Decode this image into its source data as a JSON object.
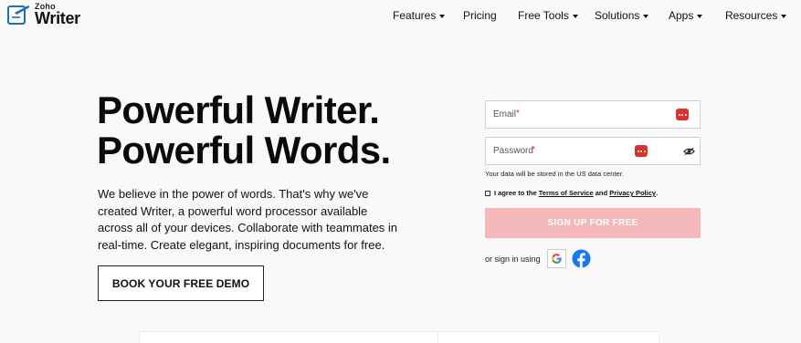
{
  "brand": {
    "zoho": "Zoho",
    "writer": "Writer",
    "accent": "#1f6fb5"
  },
  "nav": {
    "items": [
      {
        "label": "Features",
        "dropdown": true
      },
      {
        "label": "Pricing",
        "dropdown": false
      },
      {
        "label": "Free Tools",
        "dropdown": true
      },
      {
        "label": "Solutions",
        "dropdown": true
      },
      {
        "label": "Apps",
        "dropdown": true
      },
      {
        "label": "Resources",
        "dropdown": true
      }
    ]
  },
  "hero": {
    "headline_1": "Powerful Writer.",
    "headline_2": "Powerful Words.",
    "description": "We believe in the power of words. That's why we've created Writer, a powerful word processor available across all of your devices. Collaborate with teammates in real-time. Create elegant, inspiring documents for free.",
    "demo_button": "BOOK YOUR FREE DEMO"
  },
  "signup": {
    "email_placeholder": "Email",
    "password_placeholder": "Password",
    "required_mark": "*",
    "data_note": "Your data will be stored in the US data center.",
    "agree_prefix": "I agree to the",
    "terms_link": "Terms of Service",
    "agree_and": "and",
    "privacy_link": "Privacy Policy",
    "agree_suffix": ".",
    "submit_label": "SIGN UP FOR FREE",
    "submit_color": "#f4b8ba",
    "sign_in_text": "or sign in using",
    "providers": [
      "google-icon",
      "facebook-icon"
    ],
    "password_manager_color": "#d9312b"
  }
}
